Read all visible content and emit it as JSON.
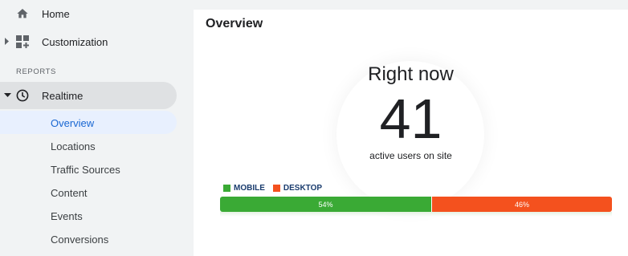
{
  "sidebar": {
    "home_label": "Home",
    "customization_label": "Customization",
    "section_header": "REPORTS",
    "realtime_label": "Realtime",
    "sub_items": [
      {
        "label": "Overview",
        "active": true
      },
      {
        "label": "Locations"
      },
      {
        "label": "Traffic Sources"
      },
      {
        "label": "Content"
      },
      {
        "label": "Events"
      },
      {
        "label": "Conversions"
      }
    ]
  },
  "main": {
    "title": "Overview",
    "right_now_label": "Right now",
    "active_count": "41",
    "active_users_label": "active users on site",
    "legend": [
      {
        "label": "MOBILE",
        "color": "#3aaa35"
      },
      {
        "label": "DESKTOP",
        "color": "#f4511e"
      }
    ],
    "breakdown": [
      {
        "label": "54%",
        "value": 0.54,
        "color": "#3aaa35"
      },
      {
        "label": "46%",
        "value": 0.46,
        "color": "#f4511e"
      }
    ]
  }
}
